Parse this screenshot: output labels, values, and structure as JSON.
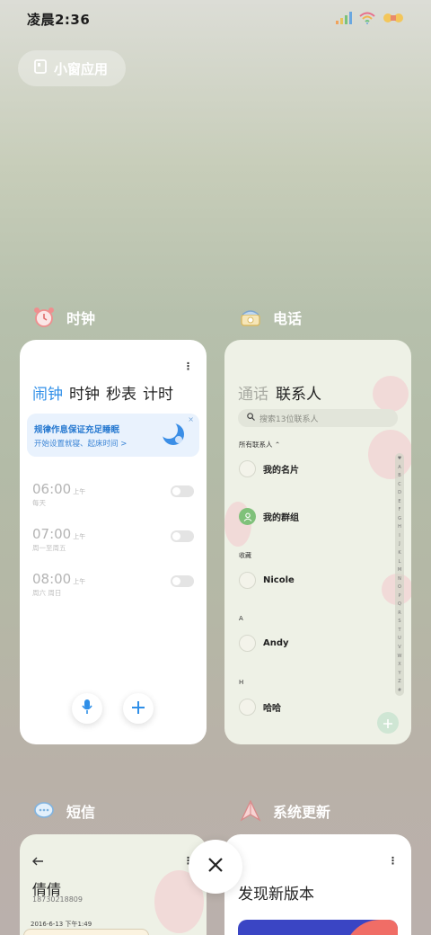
{
  "status_bar": {
    "time": "凌晨2:36"
  },
  "small_window": {
    "label": "小窗应用"
  },
  "apps": {
    "clock": {
      "name": "时钟",
      "tabs": [
        "闹钟",
        "时钟",
        "秒表",
        "计时"
      ],
      "promo": {
        "title": "规律作息保证充足睡眠",
        "subtitle": "开始设置就寝、起床时间 >"
      },
      "alarms": [
        {
          "time": "06:00",
          "ampm": "上午",
          "days": "每天",
          "enabled": false
        },
        {
          "time": "07:00",
          "ampm": "上午",
          "days": "周一至周五",
          "enabled": false
        },
        {
          "time": "08:00",
          "ampm": "上午",
          "days": "周六 周日",
          "enabled": false
        }
      ]
    },
    "phone": {
      "name": "电话",
      "tabs": {
        "calls": "通话",
        "contacts": "联系人"
      },
      "search_placeholder": "搜索13位联系人",
      "all_contacts": "所有联系人 ⌃",
      "my_card": "我的名片",
      "my_groups": "我的群组",
      "favorites_label": "收藏",
      "contacts": [
        {
          "section": "",
          "name": "Nicole"
        },
        {
          "section": "A",
          "name": "Andy"
        },
        {
          "section": "H",
          "name": "哈哈"
        }
      ],
      "index_letters": [
        "♥",
        "A",
        "B",
        "C",
        "D",
        "E",
        "F",
        "G",
        "H",
        "I",
        "J",
        "K",
        "L",
        "M",
        "N",
        "O",
        "P",
        "Q",
        "R",
        "S",
        "T",
        "U",
        "V",
        "W",
        "X",
        "Y",
        "Z",
        "#"
      ]
    },
    "sms": {
      "name": "短信",
      "contact_name": "倩倩",
      "contact_number": "18730218809",
      "date": "2016-6-13 下午1:49"
    },
    "update": {
      "name": "系统更新",
      "title": "发现新版本"
    }
  },
  "colors": {
    "accent": "#2f8fe8",
    "close": "#222222"
  }
}
